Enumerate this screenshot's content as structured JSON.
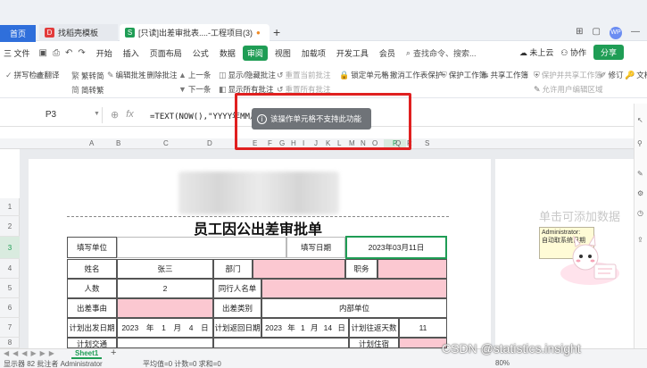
{
  "tabs": {
    "home": "首页",
    "template": "找稻壳模板",
    "file": "[只读]出差审批表....-工程项目(3)"
  },
  "menubar": {
    "file_menu": "三 文件",
    "items": [
      "开始",
      "插入",
      "页面布局",
      "公式",
      "数据",
      "审阅",
      "视图",
      "加载项",
      "开发工具",
      "会员"
    ],
    "active_index": 5,
    "search_placeholder": "查找命令、搜索...",
    "cloud": "未上云",
    "collab": "协作",
    "share": "分享",
    "avatar_initials": "WP"
  },
  "ribbon": {
    "items": [
      {
        "label": "拼写检查",
        "dim": false
      },
      {
        "label": "翻译",
        "dim": false
      },
      {
        "label": "繁转简",
        "dim": false
      },
      {
        "label": "简转繁",
        "dim": false
      },
      {
        "label": "编辑批注",
        "dim": false
      },
      {
        "label": "删除批注",
        "dim": false
      },
      {
        "label": "上一条",
        "dim": false
      },
      {
        "label": "下一条",
        "dim": false
      },
      {
        "label": "显示/隐藏批注",
        "dim": false
      },
      {
        "label": "显示所有批注",
        "dim": false
      },
      {
        "label": "重置当前批注",
        "dim": true
      },
      {
        "label": "重置所有批注",
        "dim": true
      },
      {
        "label": "锁定单元格",
        "dim": false
      },
      {
        "label": "撤消工作表保护",
        "dim": false
      },
      {
        "label": "保护工作簿",
        "dim": false
      },
      {
        "label": "共享工作簿",
        "dim": false
      },
      {
        "label": "保护并共享工作簿",
        "dim": true
      },
      {
        "label": "允许用户编辑区域",
        "dim": true
      },
      {
        "label": "修订",
        "dim": false
      },
      {
        "label": "文档权限",
        "dim": false
      }
    ]
  },
  "formula_bar": {
    "cell_ref": "P3",
    "formula": "=TEXT(NOW(),\"YYYY年MM月DD日\")"
  },
  "columns": [
    "A",
    "B",
    "C",
    "D",
    "E",
    "F",
    "G",
    "H",
    "I",
    "J",
    "K",
    "L",
    "M",
    "N",
    "O",
    "P",
    "Q",
    "R",
    "S"
  ],
  "selected_column": "P",
  "rows": [
    "1",
    "2",
    "3",
    "4",
    "5",
    "6",
    "7",
    "8"
  ],
  "selected_row": "3",
  "form": {
    "title": "员工因公出差审批单",
    "fill_unit_label": "填写单位",
    "fill_date_label": "填写日期",
    "fill_date_value": "2023年03月11日",
    "name_label": "姓名",
    "name_value": "张三",
    "dept_label": "部门",
    "position_label": "职务",
    "count_label": "人数",
    "count_value": "2",
    "companions_label": "同行人名单",
    "reason_label": "出差事由",
    "category_label": "出差类别",
    "category_value": "内部单位",
    "plan_depart_label": "计划出发日期",
    "plan_return_label": "计划返回日期",
    "plan_days_label": "计划往返天数",
    "depart_year": "2023",
    "depart_month": "1",
    "depart_day": "4",
    "return_year": "2023",
    "return_month": "1",
    "return_day": "14",
    "days_value": "11",
    "year_unit": "年",
    "month_unit": "月",
    "day_unit": "日",
    "partial_row_8a": "计划交通",
    "partial_row_8b": "计划住宿"
  },
  "panel": {
    "hint": "单击可添加数据",
    "comment_author": "Administrator:",
    "comment_text": "自动取系统日期"
  },
  "toast": {
    "message": "该操作单元格不支持此功能"
  },
  "sheets": {
    "active": "Sheet1"
  },
  "status": {
    "left": "显示器 82 批注者 Administrator",
    "mid": "平均值=0  计数=0  求和=0",
    "zoom": "80%"
  },
  "watermark": "CSDN @statistics.insight",
  "colors": {
    "accent_green": "#1f9d55",
    "pink_fill": "#fbc8d1",
    "highlight_red": "#e02020",
    "home_tab_blue": "#2f6fdb"
  }
}
